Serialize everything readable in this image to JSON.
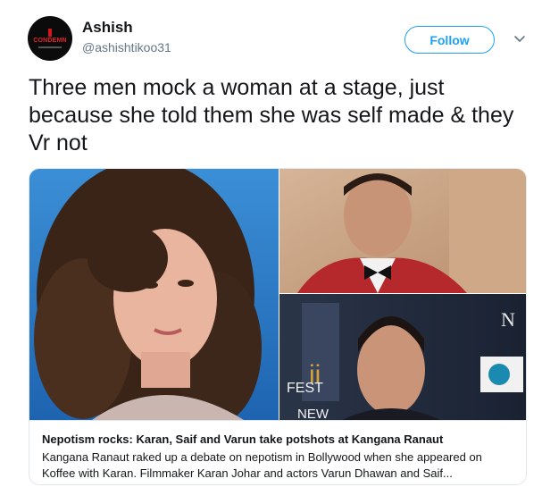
{
  "author": {
    "name": "Ashish",
    "handle": "@ashishtikoo31",
    "avatar_text": "CONDEMN"
  },
  "follow_button_label": "Follow",
  "menu_icon": "chevron-down-icon",
  "tweet": {
    "text": "Three men mock a woman at a stage, just because she told them she was self made & they Vr not"
  },
  "card": {
    "title": "Nepotism rocks: Karan, Saif and Varun take potshots at Kangana Ranaut",
    "description": "Kangana Ranaut raked up a debate on nepotism in Bollywood when she appeared on Koffee with Karan. Filmmaker Karan Johar and actors Varun Dhawan and Saif...",
    "image_signage": {
      "fest_text": "FEST",
      "new_text": "NEW",
      "right_letter": "N"
    }
  },
  "colors": {
    "accent": "#1da1f2",
    "text": "#14171a",
    "secondary": "#657786",
    "border": "#e1e8ed"
  }
}
